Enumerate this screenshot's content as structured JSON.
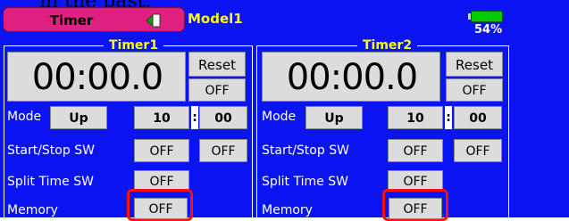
{
  "top_cut_text": "in the past.",
  "header": {
    "tab_label": "Timer",
    "model_name": "Model1",
    "battery_percent": "54%",
    "battery_level": 0.54
  },
  "timers": [
    {
      "title": "Timer1",
      "time": "00:00.0",
      "reset_label": "Reset",
      "reset_state": "OFF",
      "mode_label": "Mode",
      "mode_value": "Up",
      "minutes": "10",
      "colon": ":",
      "seconds": "00",
      "startstop_label": "Start/Stop SW",
      "startstop_sw1": "OFF",
      "startstop_sw2": "OFF",
      "split_label": "Split Time SW",
      "split_value": "OFF",
      "memory_label": "Memory",
      "memory_value": "OFF"
    },
    {
      "title": "Timer2",
      "time": "00:00.0",
      "reset_label": "Reset",
      "reset_state": "OFF",
      "mode_label": "Mode",
      "mode_value": "Up",
      "minutes": "10",
      "colon": ":",
      "seconds": "00",
      "startstop_label": "Start/Stop SW",
      "startstop_sw1": "OFF",
      "startstop_sw2": "OFF",
      "split_label": "Split Time SW",
      "split_value": "OFF",
      "memory_label": "Memory",
      "memory_value": "OFF"
    }
  ],
  "colors": {
    "screen_bg": "#0a14f0",
    "tab_bg": "#e02080",
    "title_color": "#ffff00",
    "highlight": "#ff1010"
  }
}
